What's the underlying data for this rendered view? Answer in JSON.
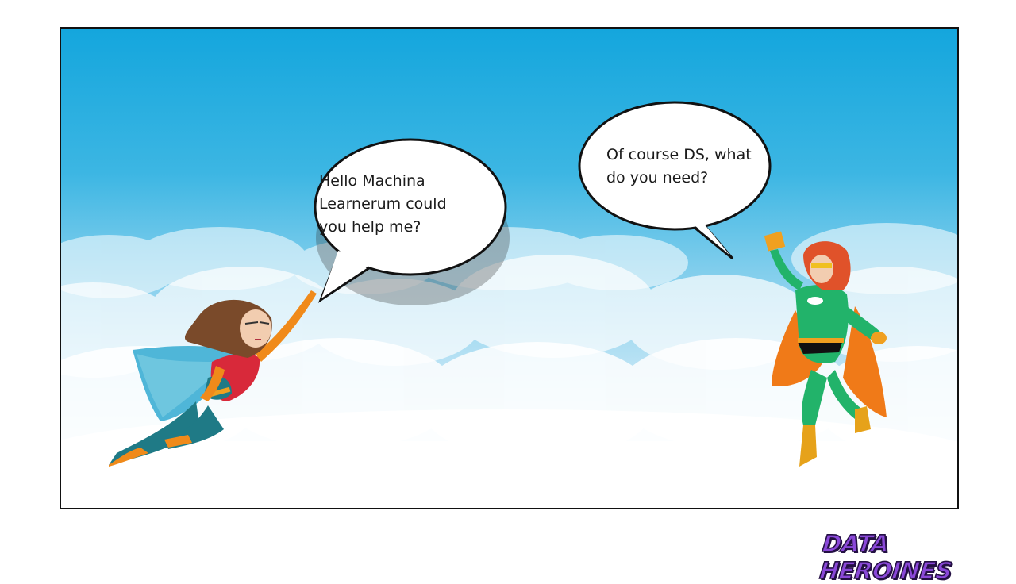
{
  "panel": {
    "left_bubble": {
      "lines": "Hello Machina\nLearnerum could\nyou help me?"
    },
    "right_bubble": {
      "lines": "Of course DS, what\ndo you need?"
    }
  },
  "branding": {
    "logo_text": "DATA HEROINES",
    "logo_color": "#8a48d8"
  },
  "colors": {
    "sky_top": "#14a6dd",
    "sky_bottom": "#ffffff",
    "hero_left_suit": "#d8293a",
    "hero_left_cape": "#4fb6d8",
    "hero_right_suit": "#22b36a",
    "hero_right_cape": "#f07a18",
    "hero_right_hair": "#e0522a"
  }
}
